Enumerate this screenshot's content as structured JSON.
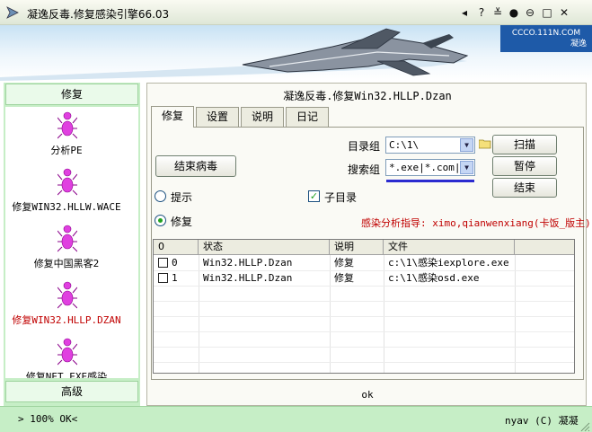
{
  "window": {
    "title": "凝逸反毒.修复感染引擎66.03",
    "controls": [
      "◂",
      "?",
      "≚",
      "●",
      "⊖",
      "□",
      "✕"
    ]
  },
  "banner": {
    "site": "CCCO.111N.COM",
    "brand": "凝逸"
  },
  "sidebar": {
    "header": "修复",
    "footer": "高级",
    "items": [
      {
        "label": "分析PE",
        "color": "#000000"
      },
      {
        "label": "修复WIN32.HLLW.WACE",
        "color": "#000000"
      },
      {
        "label": "修复中国黑客2",
        "color": "#000000"
      },
      {
        "label": "修复WIN32.HLLP.DZAN",
        "color": "#c00000"
      },
      {
        "label": "修复NET.EXE感染",
        "color": "#000000"
      }
    ]
  },
  "main": {
    "title": "凝逸反毒.修复Win32.HLLP.Dzan",
    "tabs": [
      "修复",
      "设置",
      "说明",
      "日记"
    ],
    "end_virus_button": "结束病毒",
    "dir_group_label": "目录组",
    "dir_group_value": "C:\\1\\",
    "search_group_label": "搜索组",
    "search_group_value": "*.exe|*.com|*",
    "scan_button": "扫描",
    "pause_button": "暂停",
    "end_button": "结束",
    "radio_hint": "提示",
    "radio_repair": "修复",
    "subdir_label": "子目录",
    "credit": "感染分析指导: ximo,qianwenxiang(卡饭_版主)",
    "grid": {
      "headers": [
        "0",
        "状态",
        "说明",
        "文件"
      ],
      "rows": [
        {
          "idx": "0",
          "status": "Win32.HLLP.Dzan",
          "desc": "修复",
          "file": "c:\\1\\感染iexplore.exe"
        },
        {
          "idx": "1",
          "status": "Win32.HLLP.Dzan",
          "desc": "修复",
          "file": "c:\\1\\感染osd.exe"
        }
      ]
    },
    "result": "ok"
  },
  "status": {
    "left": "> 100% OK<",
    "right": "nyav (C) 凝凝"
  },
  "colors": {
    "accent_green": "#c6eec6",
    "credit_red": "#c00000"
  }
}
